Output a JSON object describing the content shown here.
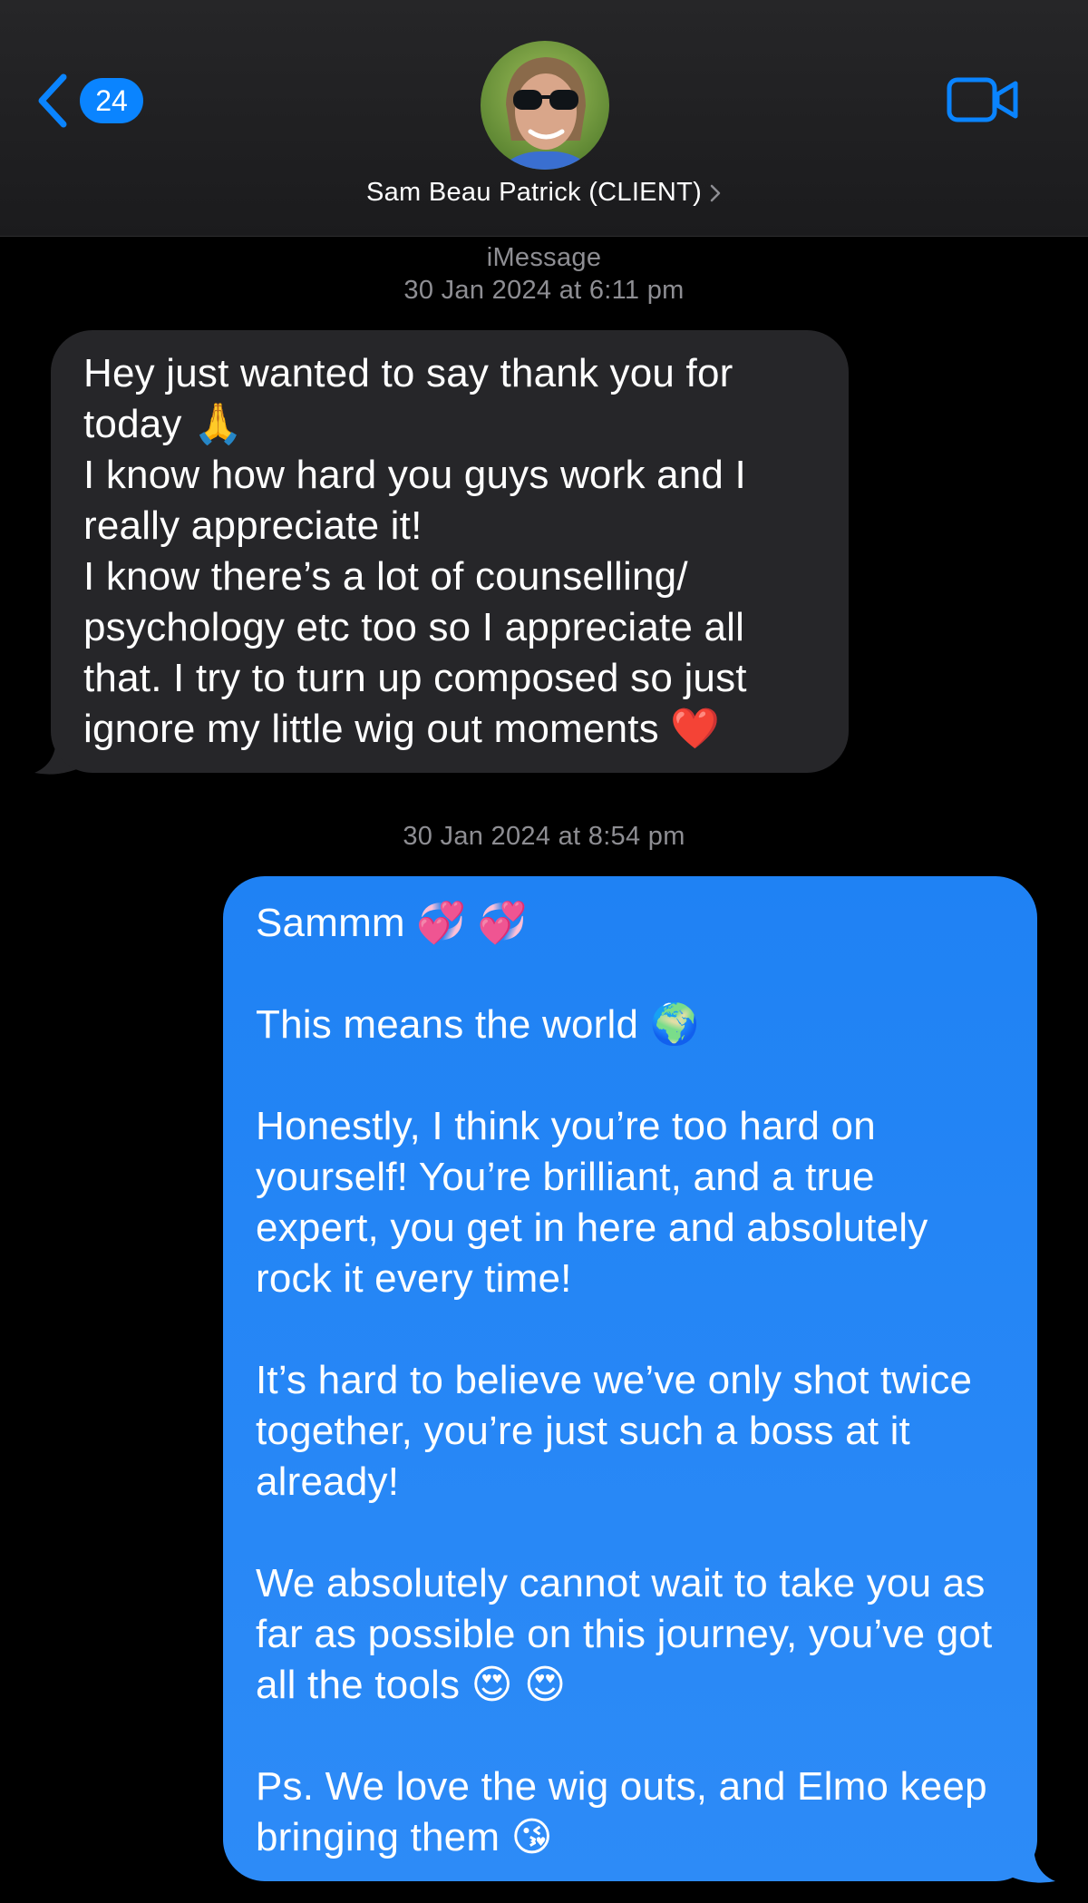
{
  "header": {
    "back_badge": "24",
    "contact_name": "Sam Beau Patrick (CLIENT)"
  },
  "thread": {
    "service_label": "iMessage",
    "timestamp_1": "30 Jan 2024 at 6:11 pm",
    "timestamp_2": "30 Jan 2024 at 8:54 pm"
  },
  "incoming_message": {
    "lines": [
      "Hey just wanted to say thank you for today 🙏",
      "I know how hard you guys work and I really appreciate it!",
      "I know there’s a lot of counselling/ psychology etc too so I appreciate all that. I try to turn up composed so just ignore my little wig out moments ❤️"
    ]
  },
  "outgoing_message": {
    "paragraphs": [
      "Sammm 💞 💞",
      "This means the world 🌍",
      "Honestly, I think you’re too hard on yourself! You’re brilliant, and a true expert, you get in here and absolutely rock it every time!",
      "It’s hard to believe we’ve only shot twice together, you’re just such a boss at it already!",
      "We absolutely cannot wait to take you as far as possible on this journey, you’ve got all the tools 😍 😍",
      "Ps. We love the wig outs, and Elmo keep bringing them 😘"
    ]
  },
  "icons": {
    "back": "chevron-left-icon",
    "video": "video-camera-icon",
    "name_chevron": "chevron-right-icon"
  },
  "colors": {
    "accent": "#0a84ff",
    "incoming_bubble": "#262629",
    "outgoing_bubble": "#1f82f4",
    "meta_text": "#8e8e93"
  }
}
